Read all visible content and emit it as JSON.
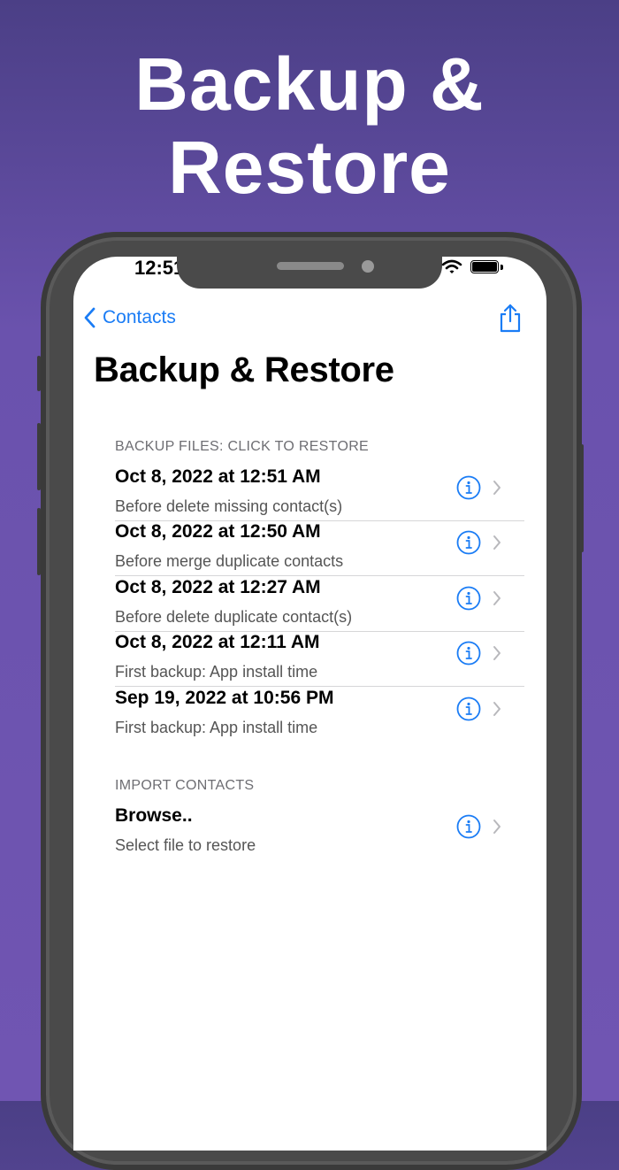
{
  "hero": {
    "line1": "Backup &",
    "line2": "Restore"
  },
  "status_bar": {
    "time": "12:51"
  },
  "nav": {
    "back_label": "Contacts"
  },
  "page": {
    "title": "Backup & Restore"
  },
  "backup_section": {
    "header": "BACKUP FILES: CLICK TO RESTORE",
    "items": [
      {
        "title": "Oct 8, 2022 at 12:51 AM",
        "subtitle": "Before delete missing contact(s)"
      },
      {
        "title": "Oct 8, 2022 at 12:50 AM",
        "subtitle": "Before merge duplicate contacts"
      },
      {
        "title": "Oct 8, 2022 at 12:27 AM",
        "subtitle": "Before delete duplicate contact(s)"
      },
      {
        "title": "Oct 8, 2022 at 12:11 AM",
        "subtitle": "First backup: App install time"
      },
      {
        "title": "Sep 19, 2022 at 10:56 PM",
        "subtitle": "First backup: App install time"
      }
    ]
  },
  "import_section": {
    "header": "IMPORT CONTACTS",
    "items": [
      {
        "title": "Browse..",
        "subtitle": "Select file to restore"
      }
    ]
  },
  "colors": {
    "accent": "#1a7cf5",
    "background_top": "#4b3f86",
    "background_bottom": "#7055b2"
  },
  "icons": [
    "chevron-left-icon",
    "share-icon",
    "info-icon",
    "chevron-right-icon",
    "wifi-icon",
    "battery-icon"
  ]
}
